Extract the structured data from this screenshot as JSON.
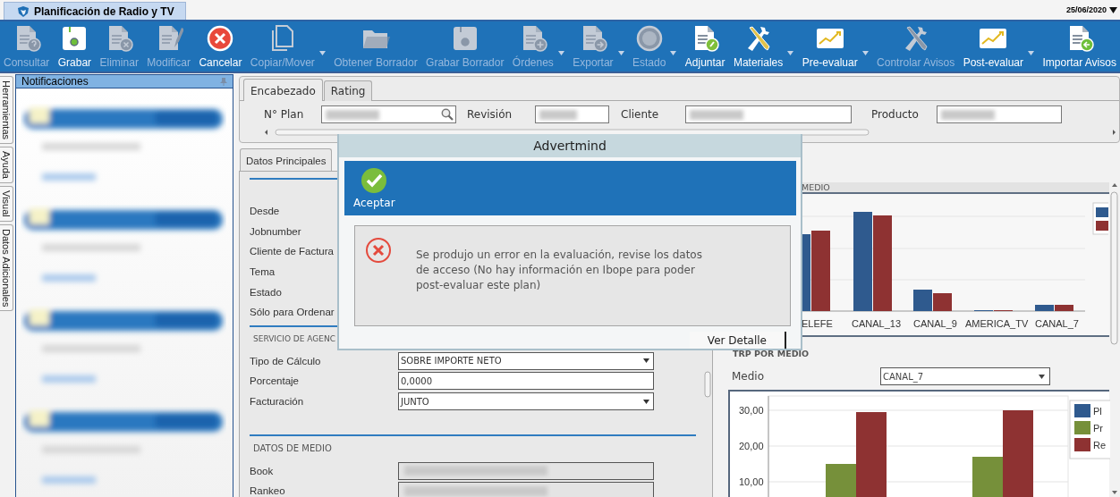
{
  "app_tab": {
    "title": "Planificación de Radio y TV",
    "selected": true
  },
  "date": "25/06/2020",
  "toolbar": [
    {
      "label": "Consultar",
      "kind": "doc-question",
      "disabled": true,
      "menu": false
    },
    {
      "label": "Grabar",
      "kind": "floppy",
      "disabled": false,
      "menu": false
    },
    {
      "label": "Eliminar",
      "kind": "doc-x",
      "disabled": true,
      "menu": false
    },
    {
      "label": "Modificar",
      "kind": "doc-pencil",
      "disabled": true,
      "menu": false
    },
    {
      "label": "Cancelar",
      "kind": "cancel",
      "disabled": false,
      "menu": false
    },
    {
      "label": "Copiar/Mover",
      "kind": "copy",
      "disabled": true,
      "menu": true
    },
    {
      "label": "Obtener Borrador",
      "kind": "folder",
      "disabled": true,
      "menu": false
    },
    {
      "label": "Grabar Borrador",
      "kind": "floppy",
      "disabled": true,
      "menu": false
    },
    {
      "label": "Órdenes",
      "kind": "doc-plus",
      "disabled": true,
      "menu": true
    },
    {
      "label": "Exportar",
      "kind": "doc-arrow",
      "disabled": true,
      "menu": true
    },
    {
      "label": "Estado",
      "kind": "disc",
      "disabled": true,
      "menu": true
    },
    {
      "label": "Adjuntar",
      "kind": "doc-clip",
      "disabled": false,
      "menu": false
    },
    {
      "label": "Materiales",
      "kind": "tools",
      "disabled": false,
      "menu": true
    },
    {
      "label": "Pre-evaluar",
      "kind": "trend",
      "disabled": false,
      "menu": true
    },
    {
      "label": "Controlar Avisos",
      "kind": "tools",
      "disabled": true,
      "menu": false
    },
    {
      "label": "Post-evaluar",
      "kind": "trend",
      "disabled": false,
      "menu": true
    },
    {
      "label": "Importar Avisos",
      "kind": "doc-import",
      "disabled": false,
      "menu": false
    }
  ],
  "side_tabs": [
    "Herramientas",
    "Ayuda",
    "Visual",
    "Datos Adicionales"
  ],
  "notifications": {
    "title": "Notificaciones",
    "items": [
      {
        "kind": "redacted"
      },
      {
        "kind": "redacted"
      },
      {
        "kind": "redacted"
      },
      {
        "kind": "redacted"
      }
    ]
  },
  "header": {
    "tabs": [
      {
        "label": "Encabezado",
        "selected": true
      },
      {
        "label": "Rating",
        "selected": false
      }
    ],
    "fields": [
      {
        "label": "N° Plan",
        "kind": "search",
        "redacted": true
      },
      {
        "label": "Revisión",
        "kind": "text",
        "redacted": true
      },
      {
        "label": "Cliente",
        "kind": "text",
        "redacted": true
      },
      {
        "label": "Producto",
        "kind": "text",
        "redacted": true
      }
    ]
  },
  "details": {
    "tab": {
      "label": "Datos Principales",
      "selected": true
    },
    "labels": [
      "Desde",
      "Jobnumber",
      "Cliente de Factura",
      "Tema",
      "Estado",
      "Sólo para Ordenar"
    ],
    "sections": [
      {
        "title": "SERVICIO DE AGENC",
        "fields": [
          {
            "label": "Tipo de Cálculo",
            "kind": "select",
            "value": "SOBRE IMPORTE NETO"
          },
          {
            "label": "Porcentaje",
            "kind": "text",
            "value": "0,0000"
          },
          {
            "label": "Facturación",
            "kind": "select",
            "value": "JUNTO"
          }
        ]
      },
      {
        "title": "DATOS DE MEDIO",
        "fields": [
          {
            "label": "Book",
            "kind": "redacted"
          },
          {
            "label": "Rankeo",
            "kind": "redacted"
          }
        ]
      }
    ]
  },
  "charts": {
    "top": {
      "title": "MEDIO",
      "categories": [
        "ELEFE",
        "CANAL_13",
        "CANAL_9",
        "AMERICA_TV",
        "CANAL_7"
      ]
    },
    "trp": {
      "title": "TRP POR MEDIO",
      "medio_label": "Medio",
      "medio_value": "CANAL_7",
      "chart_data": {
        "type": "bar",
        "series": [
          {
            "name": "Pl",
            "color": "#2f5a8e",
            "values": [
              null,
              null
            ]
          },
          {
            "name": "Pr",
            "color": "#76903a",
            "values": [
              15,
              17
            ]
          },
          {
            "name": "Re",
            "color": "#8e3232",
            "values": [
              29.5,
              30
            ]
          }
        ],
        "ylim": [
          0,
          34
        ],
        "legend": "right",
        "grid": true,
        "yticks": [
          {
            "value": 10,
            "label": "10,00"
          },
          {
            "value": 20,
            "label": "20,00"
          },
          {
            "value": 30,
            "label": "30,00"
          }
        ]
      }
    }
  },
  "dialog": {
    "title": "Advertmind",
    "accept": "Aceptar",
    "message": "Se produjo un error en la evaluación, revise los datos de acceso (No hay información en Ibope para poder post-evaluar este plan)",
    "detail_button": "Ver Detalle"
  }
}
